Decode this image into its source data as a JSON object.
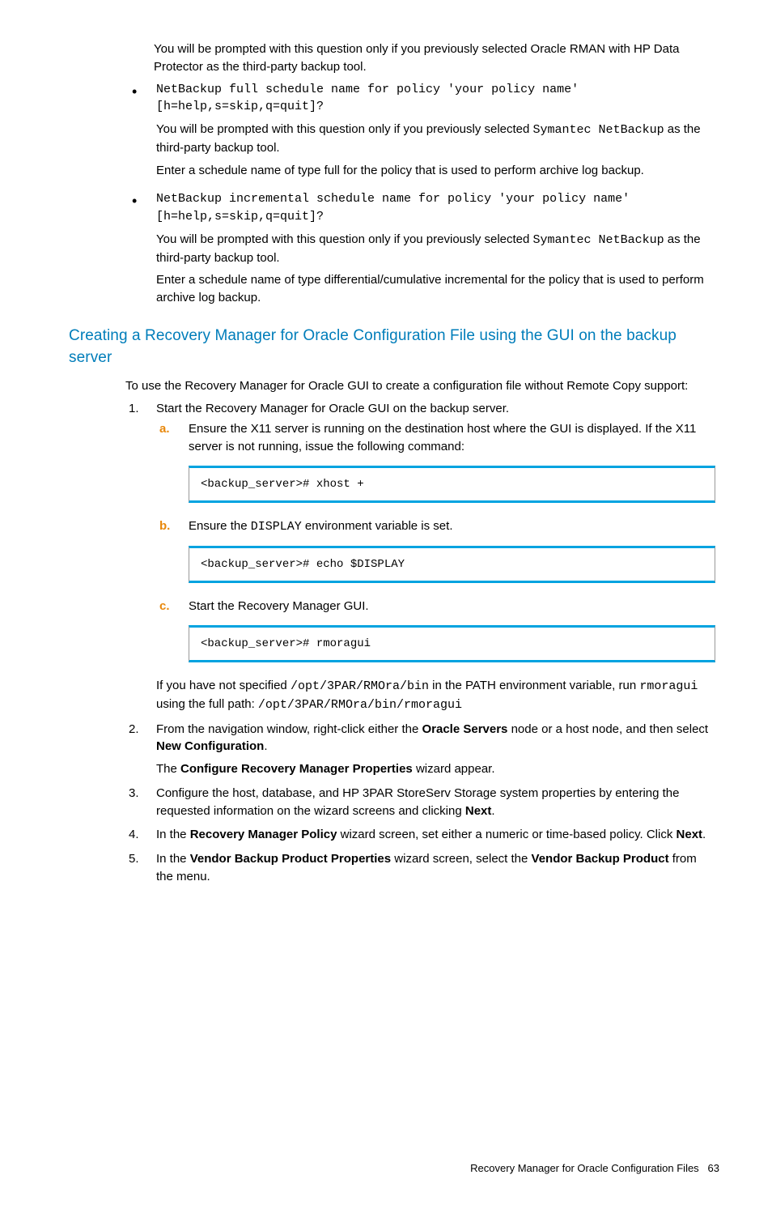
{
  "intro_para": "You will be prompted with this question only if you previously selected Oracle RMAN with HP Data Protector as the third-party backup tool.",
  "bullets": [
    {
      "code": "NetBackup full schedule name for policy 'your policy name' [h=help,s=skip,q=quit]?",
      "p1_a": "You will be prompted with this question only if you previously selected ",
      "p1_code": "Symantec NetBackup",
      "p1_b": " as the third-party backup tool.",
      "p2": "Enter a schedule name of type full for the policy that is used to perform archive log backup."
    },
    {
      "code": "NetBackup incremental schedule name for policy 'your policy name' [h=help,s=skip,q=quit]?",
      "p1_a": "You will be prompted with this question only if you previously selected ",
      "p1_code": "Symantec NetBackup",
      "p1_b": " as the third-party backup tool.",
      "p2": "Enter a schedule name of type differential/cumulative incremental for the policy that is used to perform archive log backup."
    }
  ],
  "section_title": "Creating a Recovery Manager for Oracle Configuration File using the GUI on the backup server",
  "section_intro": "To use the Recovery Manager for Oracle GUI to create a configuration file without Remote Copy support:",
  "steps": {
    "s1": {
      "text": "Start the Recovery Manager for Oracle GUI on the backup server.",
      "a": {
        "label": "a.",
        "text": "Ensure the X11 server is running on the destination host where the GUI is displayed. If the X11 server is not running, issue the following command:",
        "code": "<backup_server># xhost +"
      },
      "b": {
        "label": "b.",
        "text_a": "Ensure the ",
        "text_code": "DISPLAY",
        "text_b": " environment variable is set.",
        "code": "<backup_server># echo $DISPLAY"
      },
      "c": {
        "label": "c.",
        "text": "Start the Recovery Manager GUI.",
        "code": "<backup_server># rmoragui"
      },
      "tail_a": "If you have not specified ",
      "tail_code1": "/opt/3PAR/RMOra/bin",
      "tail_b": " in the PATH environment variable, run ",
      "tail_code2": "rmoragui",
      "tail_c": " using the full path: ",
      "tail_code3": "/opt/3PAR/RMOra/bin/rmoragui"
    },
    "s2": {
      "a": "From the navigation window, right-click either the ",
      "b1": "Oracle Servers",
      "c": " node or a host node, and then select ",
      "b2": "New Configuration",
      "d": ".",
      "line2_a": "The ",
      "line2_b": "Configure Recovery Manager Properties",
      "line2_c": " wizard appear."
    },
    "s3": {
      "a": "Configure the host, database, and HP 3PAR StoreServ Storage system properties by entering the requested information on the wizard screens and clicking ",
      "b1": "Next",
      "c": "."
    },
    "s4": {
      "a": "In the ",
      "b1": "Recovery Manager Policy",
      "c": " wizard screen, set either a numeric or time-based policy. Click ",
      "b2": "Next",
      "d": "."
    },
    "s5": {
      "a": "In the ",
      "b1": "Vendor Backup Product Properties",
      "c": " wizard screen, select the ",
      "b2": "Vendor Backup Product",
      "d": " from the menu."
    }
  },
  "footer": {
    "text": "Recovery Manager for Oracle Configuration Files",
    "page": "63"
  }
}
